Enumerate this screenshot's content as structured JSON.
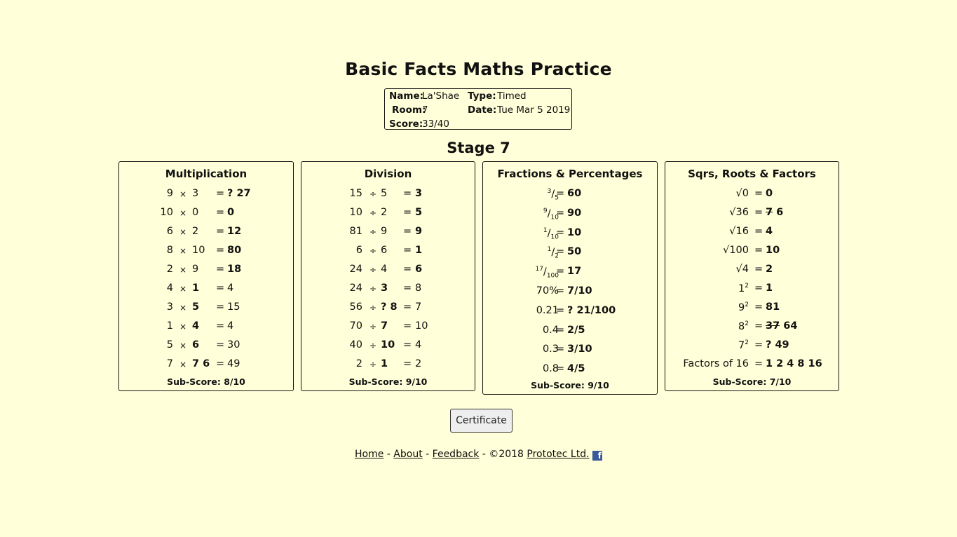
{
  "page": {
    "title": "Basic Facts Maths Practice",
    "stage": "Stage 7"
  },
  "info": {
    "name_label": "Name:",
    "name": "La'Shae",
    "type_label": "Type:",
    "type": "Timed",
    "room_label": "Room:",
    "room": "7",
    "date_label": "Date:",
    "date": "Tue Mar 5 2019",
    "score_label": "Score:",
    "score": "33/40"
  },
  "multiplication": {
    "title": "Multiplication",
    "op": "×",
    "eq": "=",
    "rows": [
      {
        "a": "9",
        "b": "3",
        "ans": "27",
        "ansPrefix": "?",
        "blank": "ans"
      },
      {
        "a": "10",
        "b": "0",
        "ans": "0",
        "blank": "ans"
      },
      {
        "a": "6",
        "b": "2",
        "ans": "12",
        "blank": "ans"
      },
      {
        "a": "8",
        "b": "10",
        "ans": "80",
        "blank": "ans"
      },
      {
        "a": "2",
        "b": "9",
        "ans": "18",
        "blank": "ans"
      },
      {
        "a": "4",
        "b": "1",
        "ans": "4",
        "blank": "b"
      },
      {
        "a": "3",
        "b": "5",
        "ans": "15",
        "blank": "b"
      },
      {
        "a": "1",
        "b": "4",
        "ans": "4",
        "blank": "b"
      },
      {
        "a": "5",
        "b": "6",
        "ans": "30",
        "blank": "b"
      },
      {
        "a": "7",
        "b": "7",
        "bWrong": "6",
        "ans": "49",
        "blank": "b"
      }
    ],
    "subscore_label": "Sub-Score:",
    "subscore": "8/10"
  },
  "division": {
    "title": "Division",
    "op": "÷",
    "eq": "=",
    "rows": [
      {
        "a": "15",
        "b": "5",
        "ans": "3",
        "blank": "ans"
      },
      {
        "a": "10",
        "b": "2",
        "ans": "5",
        "blank": "ans"
      },
      {
        "a": "81",
        "b": "9",
        "ans": "9",
        "blank": "ans"
      },
      {
        "a": "6",
        "b": "6",
        "ans": "1",
        "blank": "ans"
      },
      {
        "a": "24",
        "b": "4",
        "ans": "6",
        "blank": "ans"
      },
      {
        "a": "24",
        "b": "3",
        "ans": "8",
        "blank": "b"
      },
      {
        "a": "56",
        "b": "8",
        "bPrefix": "?",
        "ans": "7",
        "blank": "b"
      },
      {
        "a": "70",
        "b": "7",
        "ans": "10",
        "blank": "b"
      },
      {
        "a": "40",
        "b": "10",
        "ans": "4",
        "blank": "b"
      },
      {
        "a": "2",
        "b": "1",
        "ans": "2",
        "blank": "b"
      }
    ],
    "subscore_label": "Sub-Score:",
    "subscore": "9/10"
  },
  "fractions": {
    "title": "Fractions & Percentages",
    "eq": "=",
    "rows": [
      {
        "num": "3",
        "den": "5",
        "ans": "60"
      },
      {
        "num": "9",
        "den": "10",
        "ans": "90"
      },
      {
        "num": "1",
        "den": "10",
        "ans": "10"
      },
      {
        "num": "1",
        "den": "2",
        "ans": "50"
      },
      {
        "num": "17",
        "den": "100",
        "ans": "17"
      },
      {
        "q": "70%",
        "ans": "7/10"
      },
      {
        "q": "0.21",
        "ans": "21/100",
        "ansPrefix": "?"
      },
      {
        "q": "0.4",
        "ans": "2/5"
      },
      {
        "q": "0.3",
        "ans": "3/10"
      },
      {
        "q": "0.8",
        "ans": "4/5"
      }
    ],
    "subscore_label": "Sub-Score:",
    "subscore": "9/10"
  },
  "roots": {
    "title": "Sqrs, Roots & Factors",
    "eq": "=",
    "rows": [
      {
        "q": "√0",
        "ans": "0"
      },
      {
        "q": "√36",
        "wrong": "7",
        "ans": "6"
      },
      {
        "q": "√16",
        "ans": "4"
      },
      {
        "q": "√100",
        "ans": "10"
      },
      {
        "q": "√4",
        "ans": "2"
      },
      {
        "base": "1",
        "exp": "2",
        "ans": "1"
      },
      {
        "base": "9",
        "exp": "2",
        "ans": "81"
      },
      {
        "base": "8",
        "exp": "2",
        "wrong": "37",
        "ans": "64"
      },
      {
        "base": "7",
        "exp": "2",
        "ansPrefix": "?",
        "ans": "49"
      },
      {
        "q": "Factors of 16",
        "ans": "1 2 4 8 16"
      }
    ],
    "subscore_label": "Sub-Score:",
    "subscore": "7/10"
  },
  "button": {
    "certificate": "Certificate"
  },
  "footer": {
    "home": "Home",
    "about": "About",
    "feedback": "Feedback",
    "copyright": "©2018",
    "company": "Prototec Ltd.",
    "sep": "-",
    "facebook_icon": "facebook-icon"
  }
}
